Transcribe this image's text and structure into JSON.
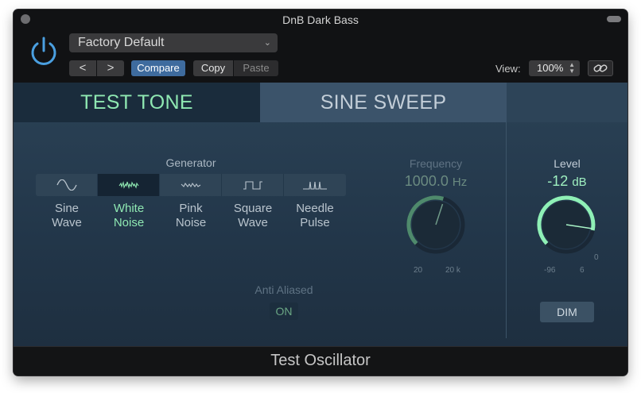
{
  "window": {
    "title": "DnB Dark Bass"
  },
  "header": {
    "preset": "Factory Default",
    "nav_prev": "<",
    "nav_next": ">",
    "compare_label": "Compare",
    "copy_label": "Copy",
    "paste_label": "Paste",
    "view_label": "View:",
    "view_value": "100%"
  },
  "tabs": [
    {
      "label": "TEST TONE",
      "active": true
    },
    {
      "label": "SINE SWEEP",
      "active": false
    }
  ],
  "generator": {
    "label": "Generator",
    "options": [
      {
        "line1": "Sine",
        "line2": "Wave",
        "icon": "sine-wave-icon",
        "active": false
      },
      {
        "line1": "White",
        "line2": "Noise",
        "icon": "white-noise-icon",
        "active": true
      },
      {
        "line1": "Pink",
        "line2": "Noise",
        "icon": "pink-noise-icon",
        "active": false
      },
      {
        "line1": "Square",
        "line2": "Wave",
        "icon": "square-wave-icon",
        "active": false
      },
      {
        "line1": "Needle",
        "line2": "Pulse",
        "icon": "needle-pulse-icon",
        "active": false
      }
    ]
  },
  "frequency": {
    "label": "Frequency",
    "value": "1000.0",
    "unit": "Hz",
    "min_label": "20",
    "max_label": "20 k"
  },
  "anti_aliased": {
    "label": "Anti Aliased",
    "value": "ON"
  },
  "level": {
    "label": "Level",
    "value": "-12",
    "unit": "dB",
    "min_label": "-96",
    "max_label": "6",
    "zero_label": "0"
  },
  "dim_label": "DIM",
  "footer": {
    "title": "Test Oscillator"
  },
  "colors": {
    "accent_green": "#8fe8b2",
    "panel_blue": "#2b4256",
    "compare_blue": "#3e6b9e",
    "power_blue": "#4a9fe0"
  }
}
